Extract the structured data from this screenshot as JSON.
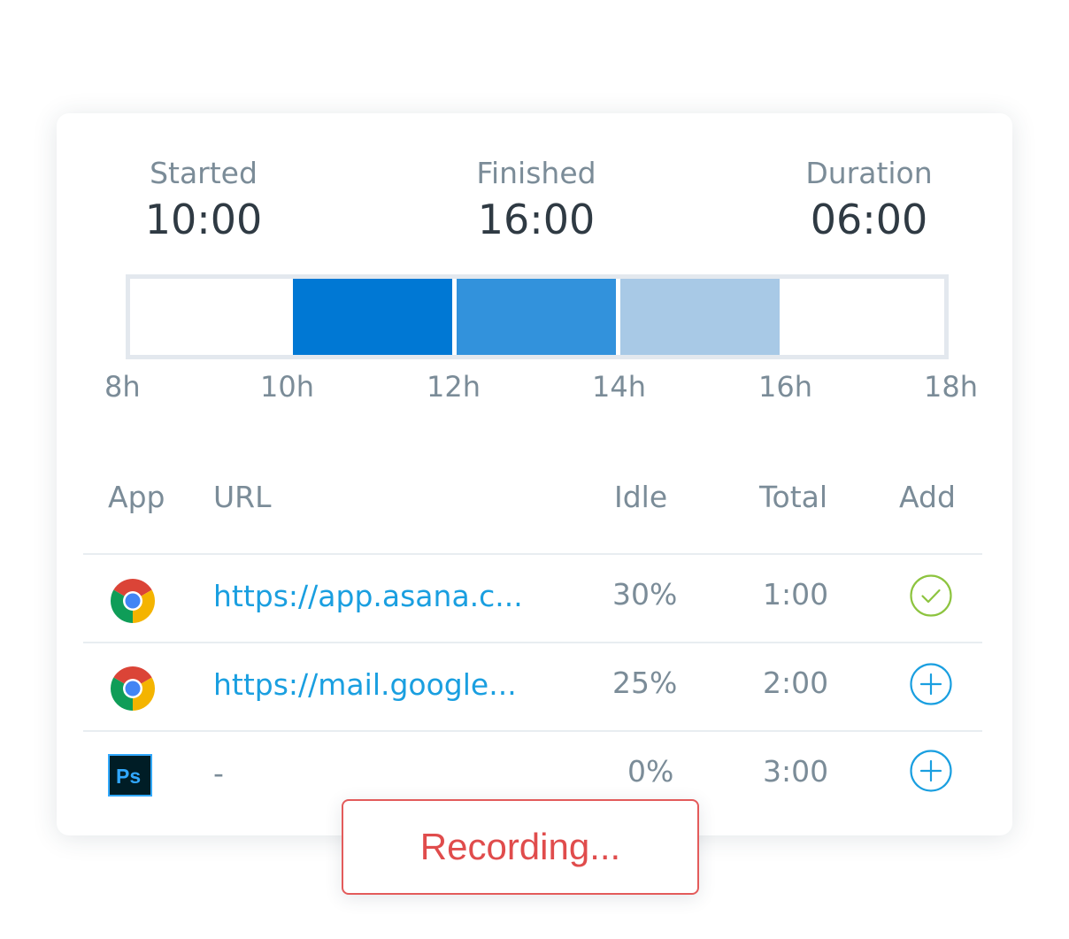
{
  "summary": {
    "started_label": "Started",
    "started_value": "10:00",
    "finished_label": "Finished",
    "finished_value": "16:00",
    "duration_label": "Duration",
    "duration_value": "06:00"
  },
  "timeline": {
    "axis_labels": [
      "8h",
      "10h",
      "12h",
      "14h",
      "16h",
      "18h"
    ],
    "colors": {
      "dark": "#0078d4",
      "medium": "#3292dc",
      "light": "#a8c9e6",
      "border": "#e3e8ee"
    }
  },
  "table": {
    "headers": {
      "app": "App",
      "url": "URL",
      "idle": "Idle",
      "total": "Total",
      "add": "Add"
    },
    "rows": [
      {
        "app_icon": "chrome-icon",
        "url": "https://app.asana.c...",
        "idle": "30%",
        "total": "1:00",
        "add_state": "added"
      },
      {
        "app_icon": "chrome-icon",
        "url": "https://mail.google...",
        "idle": "25%",
        "total": "2:00",
        "add_state": "add"
      },
      {
        "app_icon": "photoshop-icon",
        "url": "-",
        "idle": "0%",
        "total": "3:00",
        "add_state": "add"
      }
    ]
  },
  "recording": {
    "label": "Recording..."
  }
}
